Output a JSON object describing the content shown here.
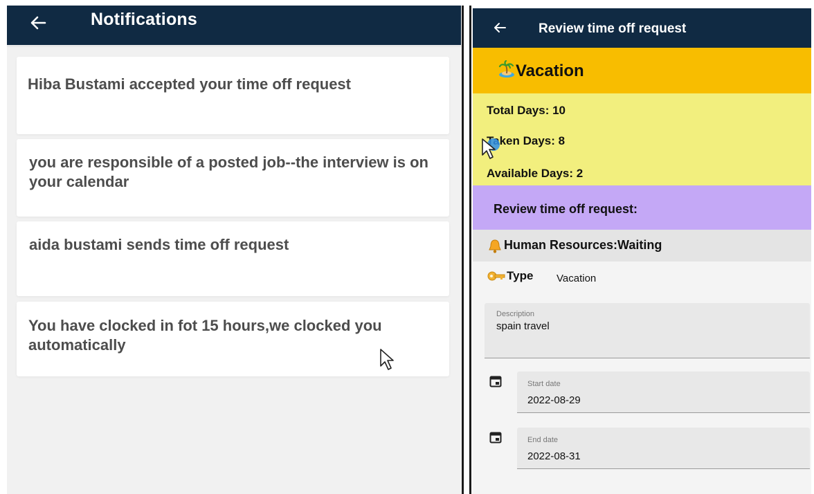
{
  "notifications_screen": {
    "title": "Notifications",
    "items": [
      {
        "text": "Hiba Bustami accepted your time off request"
      },
      {
        "text": "you are responsible of a posted job--the interview is on your calendar"
      },
      {
        "text": "aida bustami sends time off request"
      },
      {
        "text": "You have clocked in fot 15 hours,we clocked you automatically"
      }
    ]
  },
  "review_screen": {
    "title": "Review time off request",
    "leave_type": "Vacation",
    "total_days": "Total Days: 10",
    "taken_days": "Taken Days: 8",
    "available_days": "Available Days:  2",
    "review_heading": "Review time off request:",
    "approval_status": "Human Resources:Waiting",
    "type_label": "Type",
    "type_value": "Vacation",
    "description": {
      "label": "Description",
      "value": "spain travel"
    },
    "start_date": {
      "label": "Start date",
      "value": "2022-08-29"
    },
    "end_date": {
      "label": "End date",
      "value": "2022-08-31"
    }
  },
  "colors": {
    "header": "#102a43",
    "vacation_bar": "#f8bd00",
    "days_box": "#f2ef7e",
    "review_bar": "#c4a8f6"
  },
  "icons": [
    "back-arrow-icon",
    "island-icon",
    "bell-icon",
    "key-icon",
    "calendar-icon",
    "mouse-cursor-icon"
  ]
}
